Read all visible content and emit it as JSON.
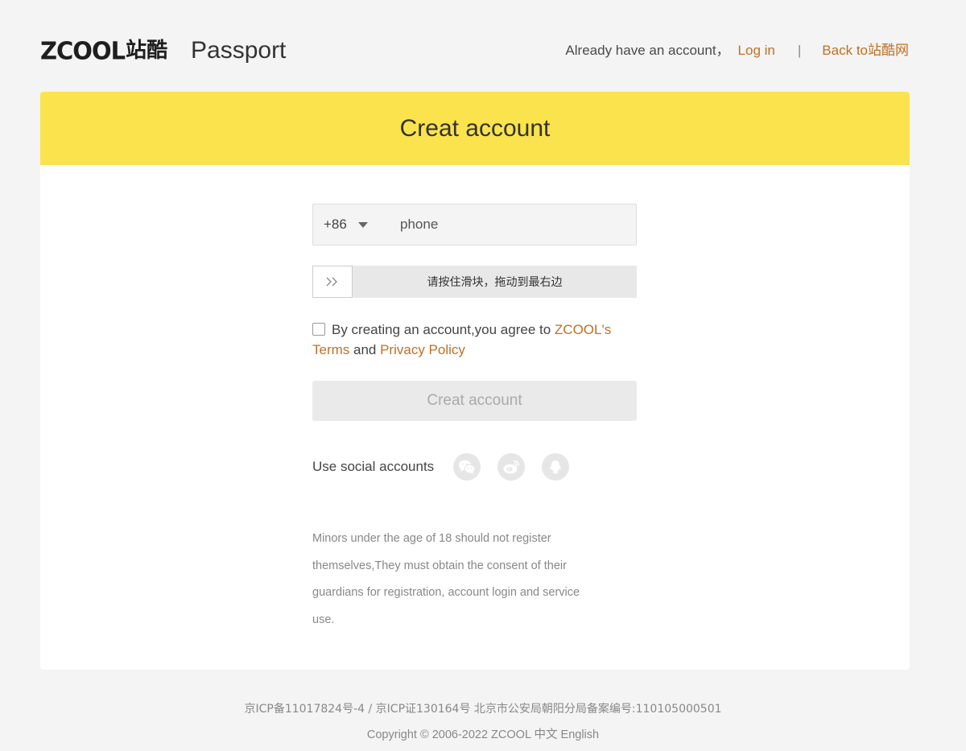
{
  "header": {
    "logo_word": "ZCOOL",
    "logo_cn": "站酷",
    "title": "Passport",
    "already_text": "Already have an account，",
    "login_link": "Log in",
    "separator": "|",
    "back_link": "Back to站酷网"
  },
  "card": {
    "title": "Creat account"
  },
  "form": {
    "country_code": "+86",
    "phone_placeholder": "phone",
    "phone_value": "",
    "slider_text": "请按住滑块，拖动到最右边",
    "agree_text_1": "By creating an account,you agree to ",
    "agree_link_brand": "ZCOOL's",
    "agree_link_terms": "Terms",
    "agree_and": " and ",
    "agree_link_privacy": "Privacy Policy",
    "submit_label": "Creat account"
  },
  "social": {
    "label": "Use social accounts",
    "icons": [
      "wechat-icon",
      "weibo-icon",
      "qq-icon"
    ]
  },
  "notice": "Minors under the age of 18 should not register themselves,They must obtain the consent of their guardians for registration, account login and service use.",
  "footer": {
    "icp": "京ICP备11017824号-4 / 京ICP证130164号 北京市公安局朝阳分局备案编号:110105000501",
    "copyright": "Copyright © 2006-2022 ZCOOL ",
    "lang_cn": "中文",
    "lang_en": "English"
  },
  "colors": {
    "accent": "#c26f22",
    "header_yellow": "#fbe34d",
    "background": "#f4f4f4"
  }
}
